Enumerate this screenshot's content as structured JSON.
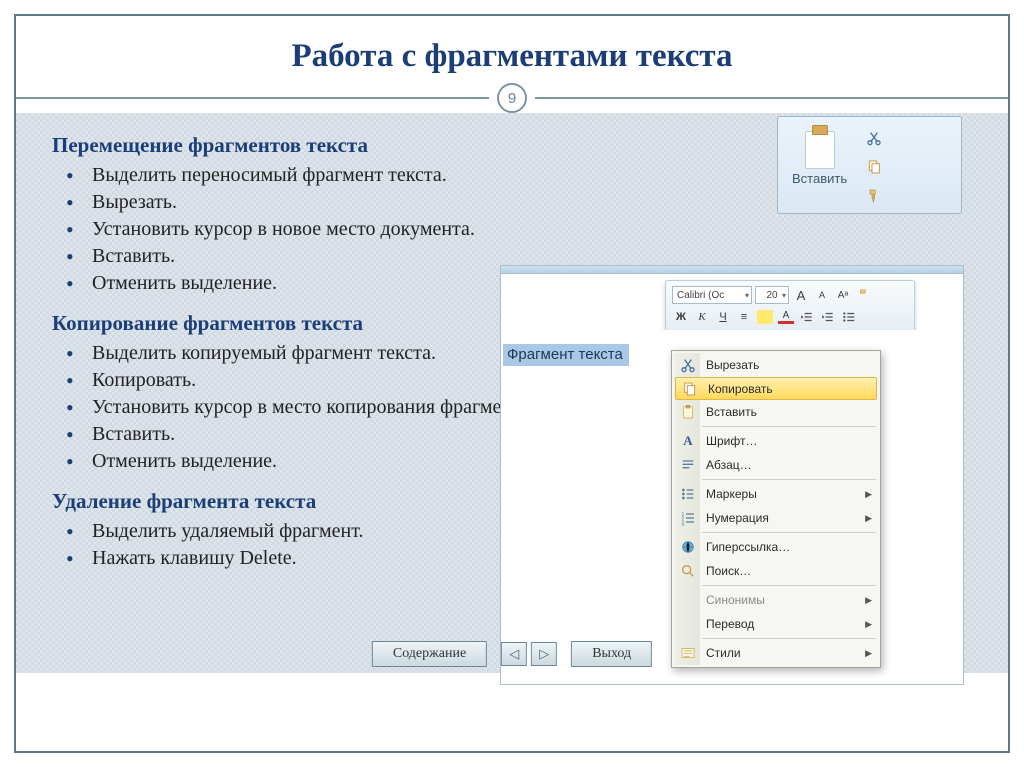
{
  "title": "Работа с фрагментами текста",
  "page_number": "9",
  "sections": {
    "move": {
      "heading": "Перемещение фрагментов текста",
      "items": [
        "Выделить переносимый фрагмент текста.",
        "Вырезать.",
        "Установить курсор в новое место документа.",
        "Вставить.",
        "Отменить выделение."
      ]
    },
    "copy": {
      "heading": "Копирование фрагментов текста",
      "items": [
        "Выделить копируемый фрагмент текста.",
        "Копировать.",
        "Установить курсор в место копирования фрагмента текста.",
        "Вставить.",
        "Отменить выделение."
      ]
    },
    "delete": {
      "heading": "Удаление фрагмента текста",
      "items": [
        "Выделить удаляемый фрагмент.",
        "Нажать клавишу Delete."
      ]
    }
  },
  "clipboard_group": {
    "paste_label": "Вставить"
  },
  "mini_toolbar": {
    "font": "Calibri (Ос",
    "size": "20",
    "btn_grow": "A",
    "btn_shrink": "A",
    "btn_bold": "Ж",
    "btn_italic": "К",
    "btn_under": "Ч",
    "btn_center": "≡",
    "btn_hl": "aʙ",
    "btn_color": "A"
  },
  "selected_text": "Фрагмент текста",
  "context_menu": {
    "cut": "Вырезать",
    "copy": "Копировать",
    "paste": "Вставить",
    "font": "Шрифт…",
    "paragraph": "Абзац…",
    "bullets": "Маркеры",
    "numbering": "Нумерация",
    "hyperlink": "Гиперссылка…",
    "search": "Поиск…",
    "synonyms": "Синонимы",
    "translate": "Перевод",
    "styles": "Стили"
  },
  "nav": {
    "contents": "Содержание",
    "exit": "Выход"
  }
}
